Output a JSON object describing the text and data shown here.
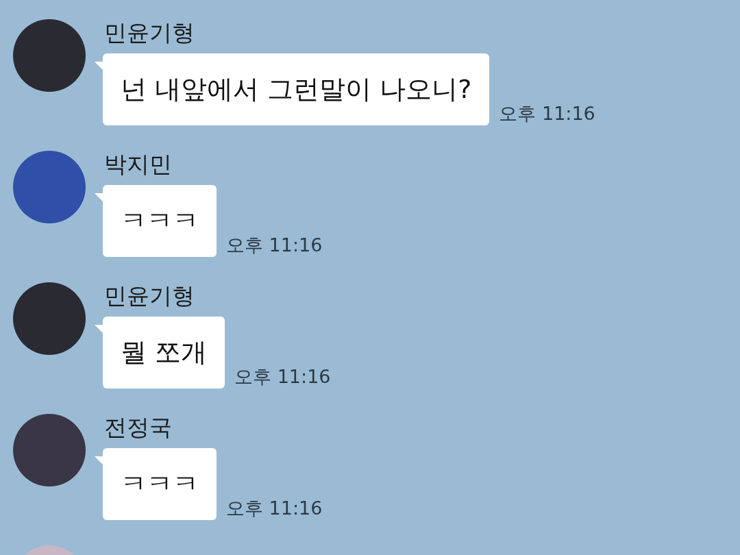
{
  "messages": [
    {
      "name": "민윤기형",
      "text": "넌 내앞에서 그런말이 나오니?",
      "time": "오후 11:16",
      "color": "#2a2a33"
    },
    {
      "name": "박지민",
      "text": "ㅋㅋㅋ",
      "time": "오후 11:16",
      "color": "#2f4fa8"
    },
    {
      "name": "민윤기형",
      "text": "뭘 쪼개",
      "time": "오후 11:16",
      "color": "#2a2a33"
    },
    {
      "name": "전정국",
      "text": "ㅋㅋㅋ",
      "time": "오후 11:16",
      "color": "#3a3646"
    }
  ],
  "cut_off_avatar": {
    "color": "#c9b6c4"
  }
}
